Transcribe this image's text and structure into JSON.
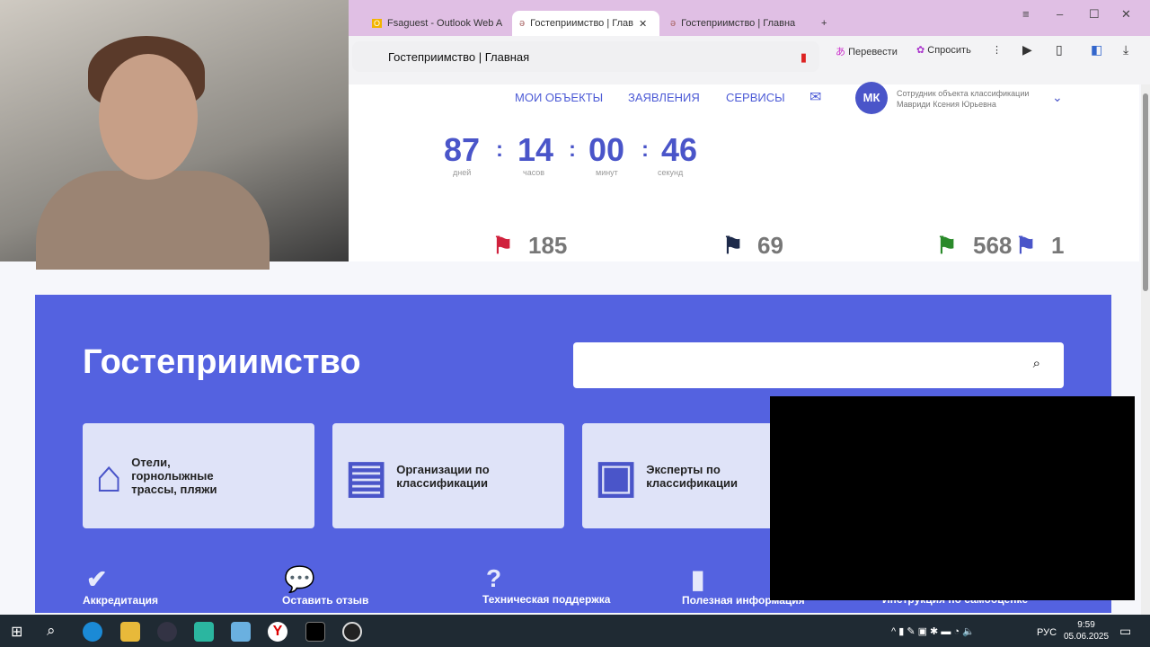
{
  "browser": {
    "tabs": [
      {
        "label": "Fsaguest - Outlook Web A"
      },
      {
        "label": "Гостеприимство | Глав"
      },
      {
        "label": "Гостеприимство | Главна"
      }
    ],
    "address_title": "Гостеприимство | Главная",
    "translate_label": "Перевести",
    "ask_label": "Спросить"
  },
  "nav": {
    "items": [
      "МОИ ОБЪЕКТЫ",
      "ЗАЯВЛЕНИЯ",
      "СЕРВИСЫ"
    ],
    "user": {
      "initials": "МК",
      "role": "Сотрудник объекта классификации",
      "name": "Мавриди Ксения Юрьевна"
    }
  },
  "countdown": {
    "days": "87",
    "days_label": "дней",
    "hours": "14",
    "hours_label": "часов",
    "minutes": "00",
    "minutes_label": "минут",
    "seconds": "46",
    "seconds_label": "секунд",
    "sep": ":"
  },
  "stats": {
    "red": "185",
    "dark": "69",
    "multi": "568",
    "blue": "1"
  },
  "hero": {
    "title": "Гостеприимство"
  },
  "cards": [
    "Отели, горнолыжные трассы, пляжи",
    "Организации по классификации",
    "Эксперты по классификации"
  ],
  "services": [
    "Аккредитация",
    "Оставить отзыв",
    "Техническая поддержка",
    "Полезная информация",
    "Инструкция по самооценке"
  ],
  "taskbar": {
    "lang": "РУС",
    "time": "9:59",
    "date": "05.06.2025"
  },
  "colors": {
    "accent": "#5462e0",
    "tabbar": "#e0bfe4"
  }
}
